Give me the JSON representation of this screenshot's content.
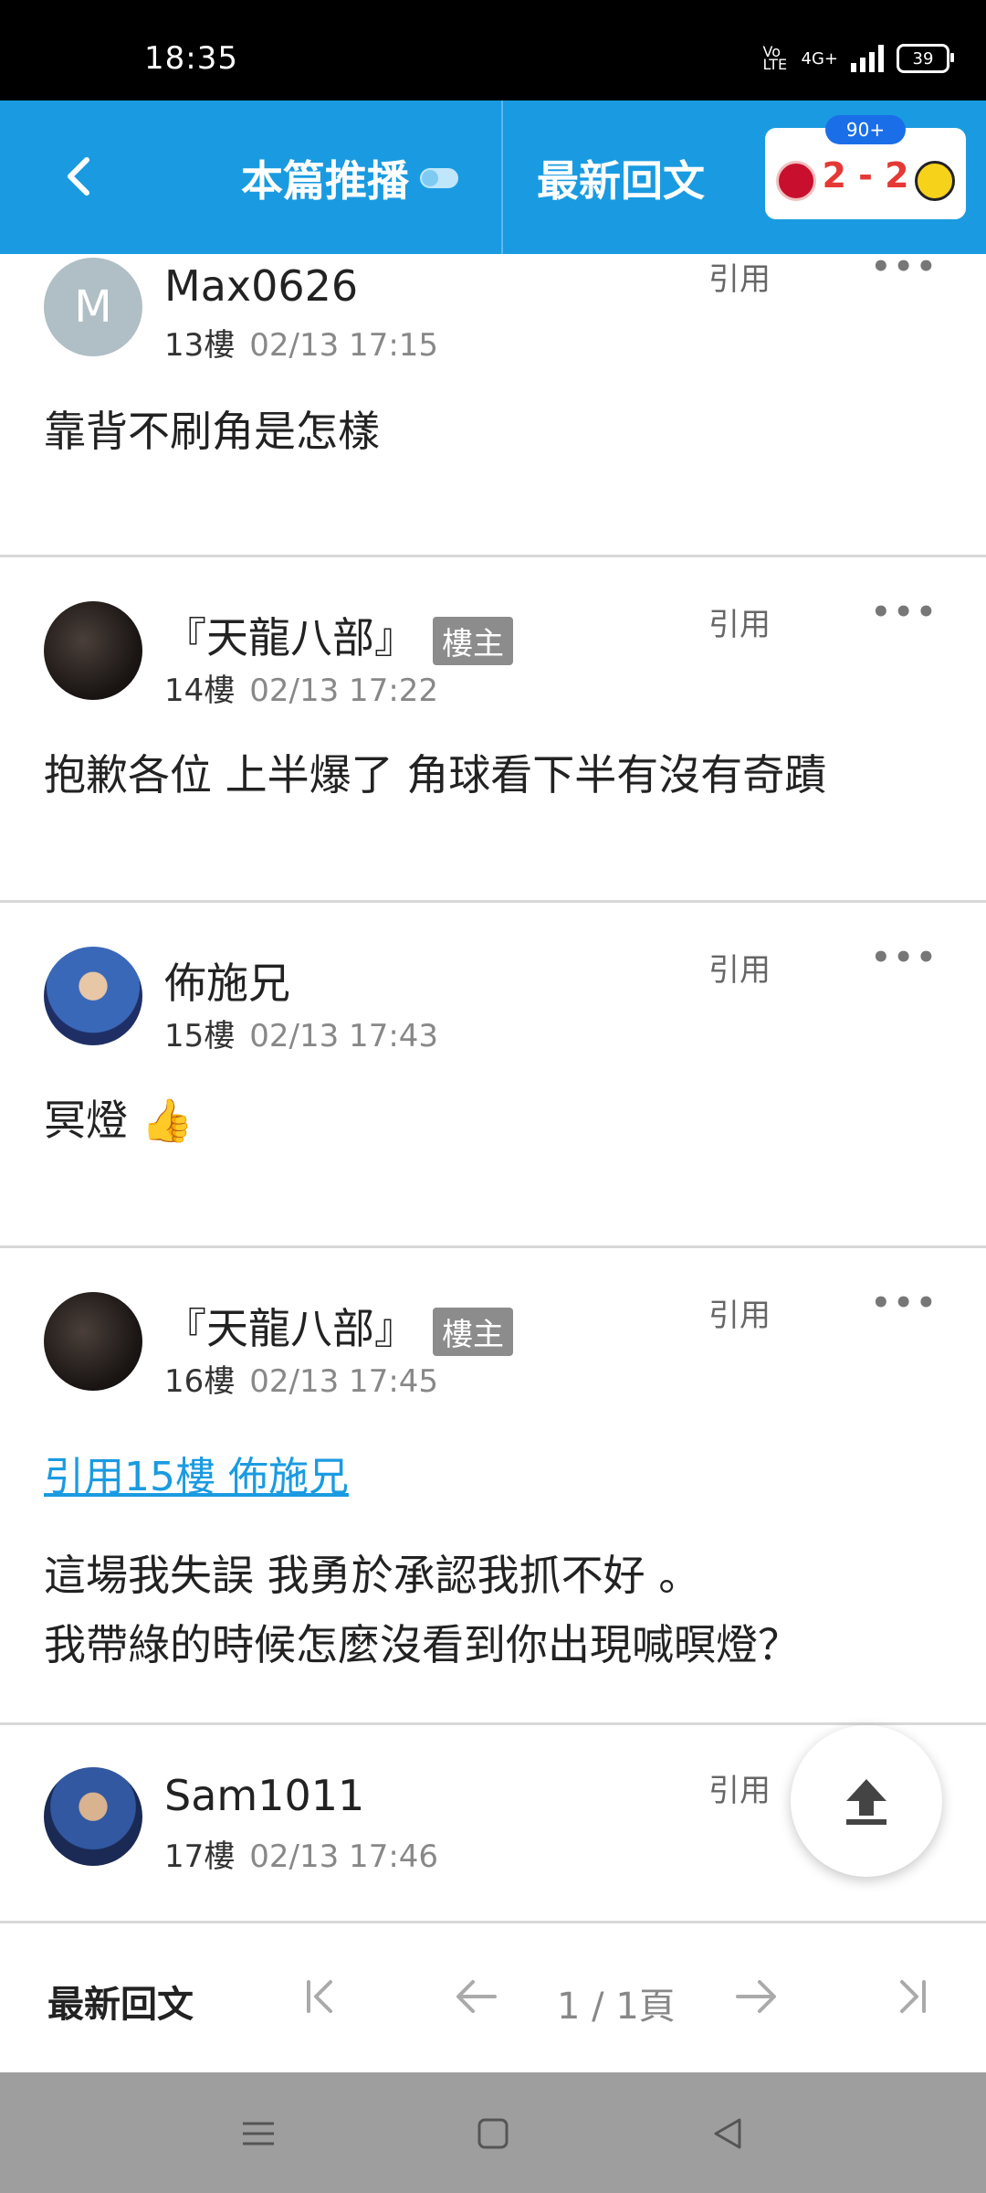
{
  "status_bar": {
    "time": "18:35",
    "network": "4G+",
    "volte": "Vo LTE",
    "battery": "39"
  },
  "header": {
    "back_icon": "chevron-left-icon",
    "title": "本篇推播",
    "latest_replies": "最新回文",
    "score": {
      "badge": "90+",
      "text": "2 - 2"
    }
  },
  "posts": [
    {
      "avatar_letter": "M",
      "username": "Max0626",
      "floor": "13樓",
      "datetime": "02/13 17:15",
      "content": "靠背不刷角是怎樣",
      "quote_label": "引用",
      "more": "•••"
    },
    {
      "username": "『天龍八部』",
      "owner_tag": "樓主",
      "floor": "14樓",
      "datetime": "02/13 17:22",
      "content": "抱歉各位 上半爆了 角球看下半有沒有奇蹟",
      "quote_label": "引用",
      "more": "•••"
    },
    {
      "username": "佈施兄",
      "floor": "15樓",
      "datetime": "02/13 17:43",
      "content": "冥燈 👍",
      "quote_label": "引用",
      "more": "•••"
    },
    {
      "username": "『天龍八部』",
      "owner_tag": "樓主",
      "floor": "16樓",
      "datetime": "02/13 17:45",
      "quote_link": "引用15樓 佈施兄",
      "content_lines": [
        "這場我失誤 我勇於承認我抓不好 。",
        "我帶綠的時候怎麼沒看到你出現喊暝燈？"
      ],
      "quote_label": "引用",
      "more": "•••"
    },
    {
      "username": "Sam1011",
      "floor": "17樓",
      "datetime": "02/13 17:46",
      "quote_label": "引用"
    }
  ],
  "fab": {
    "icon": "scroll-to-top-icon"
  },
  "pager": {
    "latest": "最新回文",
    "page_text": "1 / 1頁",
    "icons": [
      "first-page-icon",
      "prev-page-icon",
      "next-page-icon",
      "last-page-icon"
    ]
  },
  "navbar": {
    "icons": [
      "menu-icon",
      "home-icon",
      "back-icon"
    ]
  }
}
